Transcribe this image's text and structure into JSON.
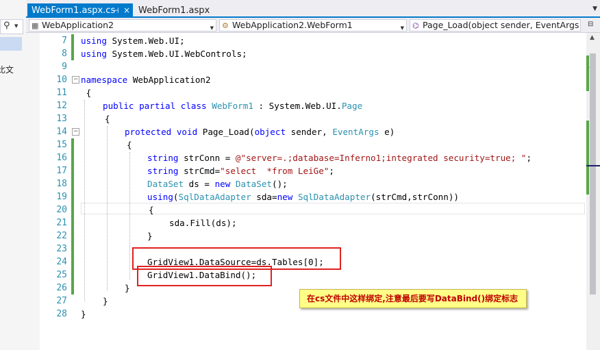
{
  "left_panel": {
    "pin_glyph": "ᅟ",
    "fragment_text": "比文"
  },
  "tabs": [
    {
      "label": "WebForm1.aspx.cs",
      "active": true,
      "pin": "⊣",
      "close": "×"
    },
    {
      "label": "WebForm1.aspx",
      "active": false
    }
  ],
  "navbar": {
    "project": "WebApplication2",
    "class": "WebApplication2.WebForm1",
    "member": "Page_Load(object sender, EventArgs e)"
  },
  "line_numbers": [
    "7",
    "8",
    "9",
    "10",
    "11",
    "12",
    "13",
    "14",
    "15",
    "16",
    "17",
    "18",
    "19",
    "20",
    "21",
    "22",
    "23",
    "24",
    "25",
    "26",
    "27",
    "28"
  ],
  "code": {
    "l7": [
      "using",
      " System.Web.UI;"
    ],
    "l8": [
      "using",
      " System.Web.UI.WebControls;"
    ],
    "l10": [
      "namespace",
      " WebApplication2"
    ],
    "l11": " {",
    "l12": [
      "public partial class",
      " ",
      "WebForm1",
      " : System.Web.UI.",
      "Page"
    ],
    "l13": "{",
    "l14": [
      "protected void",
      " Page_Load(",
      "object",
      " sender, ",
      "EventArgs",
      " e)"
    ],
    "l15": "{",
    "l16": [
      "string",
      " strConn = ",
      "@\"server=.;database=Inferno1;integrated security=true; \"",
      ";"
    ],
    "l17": [
      "string",
      " strCmd=",
      "\"select  *from LeiGe\"",
      ";"
    ],
    "l18": [
      "DataSet",
      " ds = ",
      "new",
      " ",
      "DataSet",
      "();"
    ],
    "l19": [
      "using",
      "(",
      "SqlDataAdapter",
      " sda=",
      "new",
      " ",
      "SqlDataAdapter",
      "(strCmd,strConn))"
    ],
    "l20": "{",
    "l21": "sda.Fill(ds);",
    "l22": "}",
    "l24": "GridView1.DataSource=ds.Tables[0];",
    "l25": "GridView1.DataBind();",
    "l26": "}",
    "l27": "}",
    "l28": "}"
  },
  "annotation": {
    "note": "在cs文件中这样绑定,注意最后要写DataBind()绑定标志"
  },
  "colors": {
    "keyword": "#0000ff",
    "type": "#2b91af",
    "string": "#a31515",
    "change_marker": "#57a64a",
    "highlight_box": "#e02020",
    "note_bg": "#ffff88",
    "note_text": "#c00000"
  }
}
